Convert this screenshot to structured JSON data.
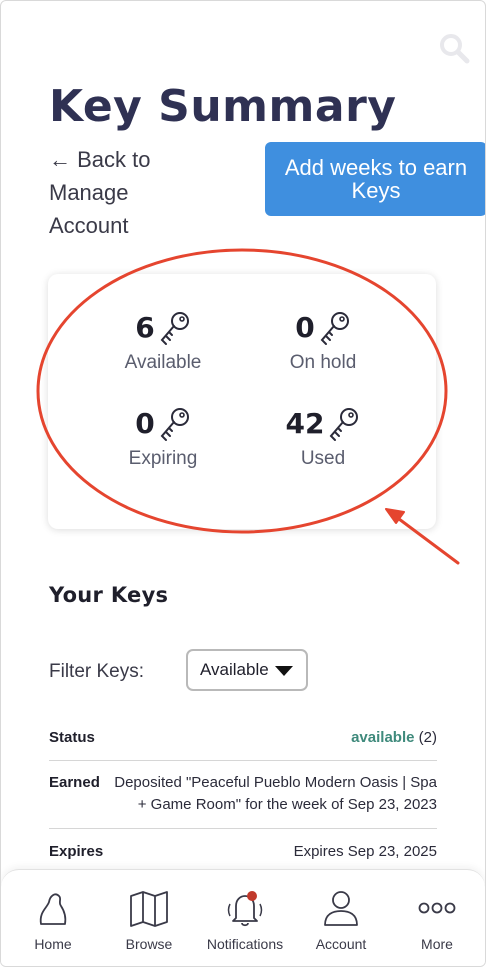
{
  "header": {
    "title": "Key Summary",
    "back_link": "← Back to Manage Account",
    "add_weeks_button": "Add weeks to earn Keys"
  },
  "summary": {
    "available": {
      "count": "6",
      "label": "Available"
    },
    "on_hold": {
      "count": "0",
      "label": "On hold"
    },
    "expiring": {
      "count": "0",
      "label": "Expiring"
    },
    "used": {
      "count": "42",
      "label": "Used"
    }
  },
  "your_keys": {
    "title": "Your Keys",
    "filter_label": "Filter Keys:",
    "filter_value": "Available",
    "status_label": "Status",
    "status_value": "available",
    "status_count": "(2)",
    "earned_label": "Earned",
    "earned_value": "Deposited \"Peaceful Pueblo Modern Oasis | Spa + Game Room\" for the week of Sep 23, 2023",
    "expires_label": "Expires",
    "expires_value": "Expires Sep 23, 2025"
  },
  "nav": {
    "home": "Home",
    "browse": "Browse",
    "notifications": "Notifications",
    "account": "Account",
    "more": "More"
  },
  "colors": {
    "title": "#2f3153",
    "button": "#3f8fdf",
    "status_available": "#3f8a7c",
    "annotation": "#e5452f",
    "notification_dot": "#c0392b"
  },
  "icons": [
    "search-icon",
    "key-icon",
    "home-icon",
    "map-icon",
    "bell-icon",
    "person-icon",
    "more-icon"
  ]
}
